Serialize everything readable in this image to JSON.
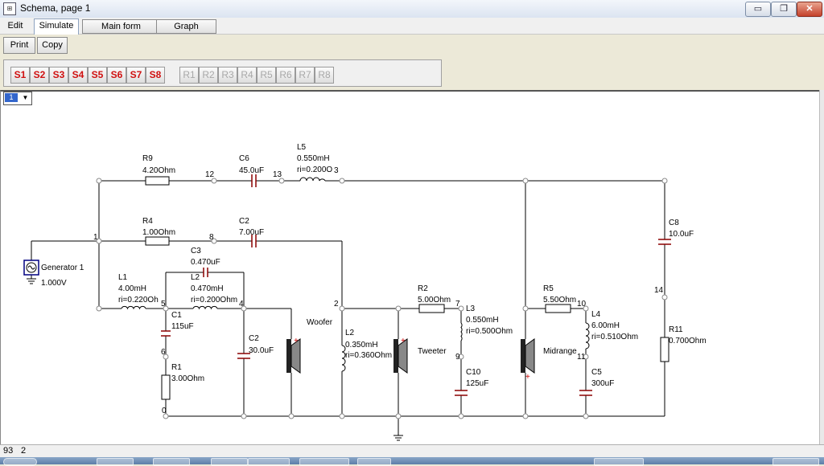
{
  "window": {
    "title": "Schema, page 1",
    "controls": [
      "▭",
      "❐",
      "✕"
    ]
  },
  "menus": {
    "edit": "Edit",
    "simulate": "Simulate",
    "main_form": "Main form",
    "graph": "Graph"
  },
  "toolbar": {
    "print": "Print",
    "copy": "Copy"
  },
  "sources": [
    "S1",
    "S2",
    "S3",
    "S4",
    "S5",
    "S6",
    "S7",
    "S8"
  ],
  "responses": [
    "R1",
    "R2",
    "R3",
    "R4",
    "R5",
    "R6",
    "R7",
    "R8"
  ],
  "page_selector": {
    "value": "1"
  },
  "status": {
    "left": "93",
    "right": "2"
  },
  "schematic": {
    "r9": {
      "name": "R9",
      "value": "4.20Ohm"
    },
    "c6": {
      "name": "C6",
      "value": "45.0uF"
    },
    "l5": {
      "name": "L5",
      "value": "0.550mH",
      "ri": "ri=0.200O"
    },
    "r4": {
      "name": "R4",
      "value": "1.00Ohm"
    },
    "c2a": {
      "name": "C2",
      "value": "7.00uF"
    },
    "c3": {
      "name": "C3",
      "value": "0.470uF"
    },
    "l2a": {
      "name": "L2",
      "value": "0.470mH",
      "ri": "ri=0.200Ohm"
    },
    "l1": {
      "name": "L1",
      "value": "4.00mH",
      "ri": "ri=0.220Oh"
    },
    "c1": {
      "name": "C1",
      "value": "115uF"
    },
    "r1": {
      "name": "R1",
      "value": "3.00Ohm"
    },
    "c2b": {
      "name": "C2",
      "value": "30.0uF"
    },
    "woofer": "Woofer",
    "l2b": {
      "name": "L2",
      "value": "0.350mH",
      "ri": "ri=0.360Ohm"
    },
    "r2": {
      "name": "R2",
      "value": "5.00Ohm"
    },
    "l3": {
      "name": "L3",
      "value": "0.550mH",
      "ri": "ri=0.500Ohm"
    },
    "tweeter": "Tweeter",
    "c10": {
      "name": "C10",
      "value": "125uF"
    },
    "r5": {
      "name": "R5",
      "value": "5.50Ohm"
    },
    "l4": {
      "name": "L4",
      "value": "6.00mH",
      "ri": "ri=0.510Ohm"
    },
    "midrange": "Midrange",
    "c5": {
      "name": "C5",
      "value": "300uF"
    },
    "c8": {
      "name": "C8",
      "value": "10.0uF"
    },
    "r11": {
      "name": "R11",
      "value": "0.700Ohm"
    },
    "generator": {
      "name": "Generator 1",
      "value": "1.000V"
    },
    "nodes": {
      "n0": "0",
      "n1": "1",
      "n2": "2",
      "n3": "3",
      "n4": "4",
      "n5": "5",
      "n6": "6",
      "n7": "7",
      "n8": "8",
      "n9": "9",
      "n10": "10",
      "n11": "11",
      "n12": "12",
      "n13": "13",
      "n14": "14"
    },
    "polarity": "+"
  },
  "colors": {
    "wire": "#000000",
    "capacitor": "#8b0000",
    "speaker_plus": "#cc0000",
    "inductor": "#000000"
  }
}
